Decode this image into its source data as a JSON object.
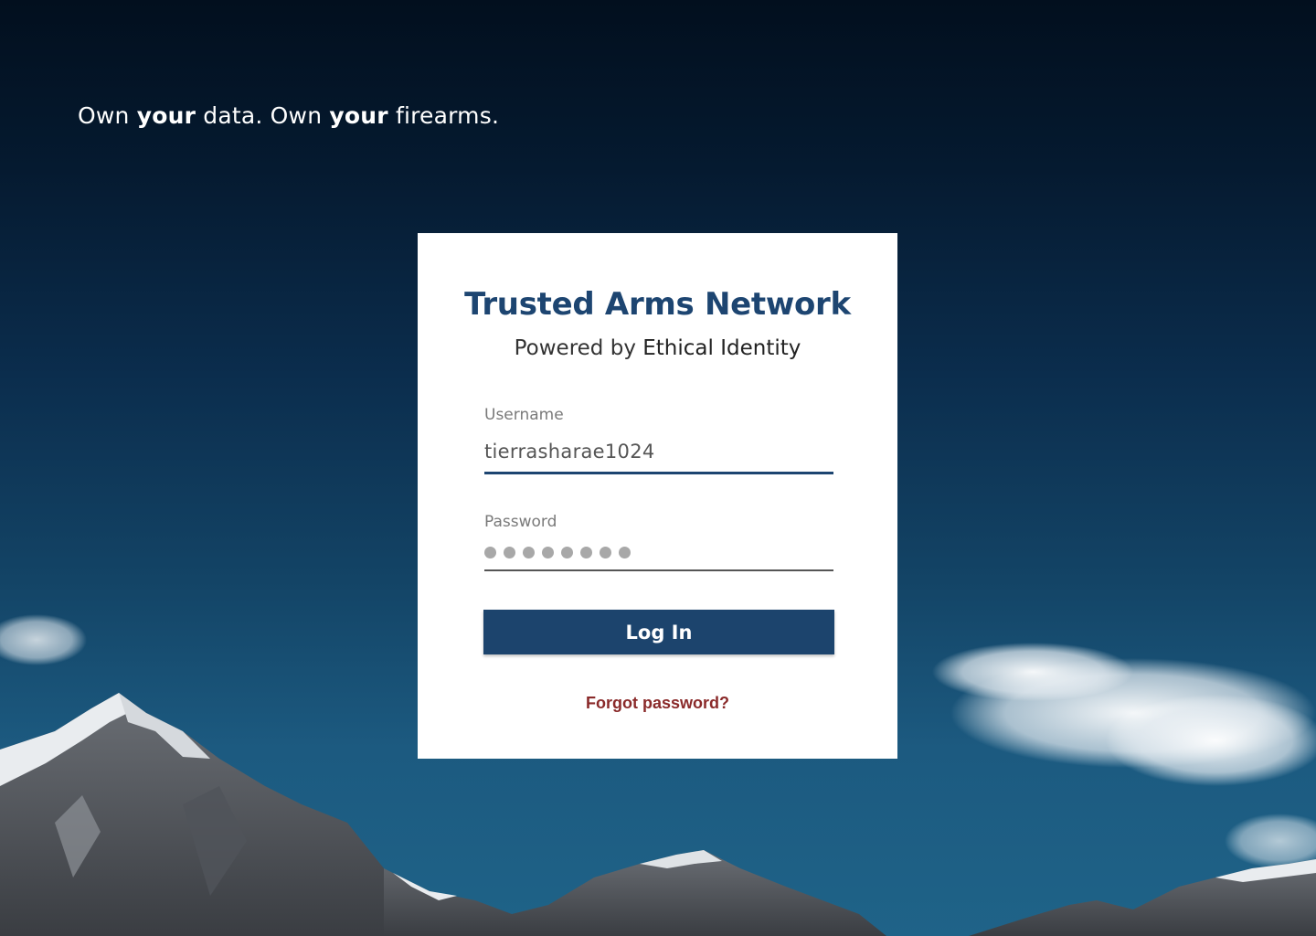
{
  "tagline": {
    "part1": "Own ",
    "bold1": "your",
    "part2": " data. Own ",
    "bold2": "your",
    "part3": " firearms."
  },
  "card": {
    "title": "Trusted Arms Network",
    "subtitle_prefix": "Powered by ",
    "subtitle_brand": "Ethical Identity"
  },
  "form": {
    "username_label": "Username",
    "username_value": "tierrasharae1024",
    "password_label": "Password",
    "password_mask_count": 8,
    "login_label": "Log In",
    "forgot_label": "Forgot password?"
  },
  "colors": {
    "primary": "#1c446d",
    "link": "#8a2a2a"
  }
}
